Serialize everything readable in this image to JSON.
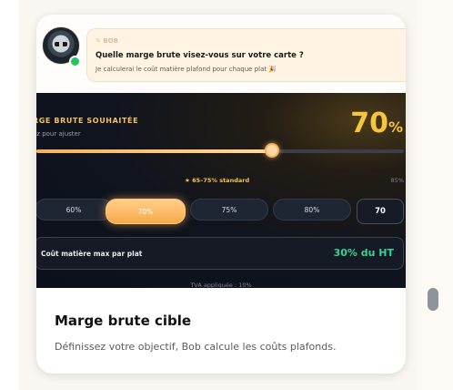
{
  "chat": {
    "sender": "BOB",
    "question": "Quelle marge brute visez-vous sur votre carte ?",
    "subtext": "Je calculerai le coût matière plafond pour chaque plat 🎉"
  },
  "margin_panel": {
    "title": "RGE BRUTE SOUHAITÉE",
    "subtitle": "ez pour ajuster",
    "value": "70",
    "unit": "%",
    "slider_fraction": 0.64,
    "standard_label": "★ 65–75% standard",
    "max_label": "85%",
    "presets": [
      "60%",
      "70%",
      "75%",
      "80%"
    ],
    "active_preset": "70%",
    "custom_value": "70",
    "cost_label": "Coût matière max par plat",
    "cost_value": "30% du HT",
    "vat_note": "TVA appliquée : 10%"
  },
  "card": {
    "title": "Marge brute cible",
    "description": "Définissez votre objectif, Bob calcule les coûts plafonds."
  },
  "colors": {
    "accent": "#f5c63c",
    "cost_value": "#34d399",
    "online": "#22c55e"
  }
}
